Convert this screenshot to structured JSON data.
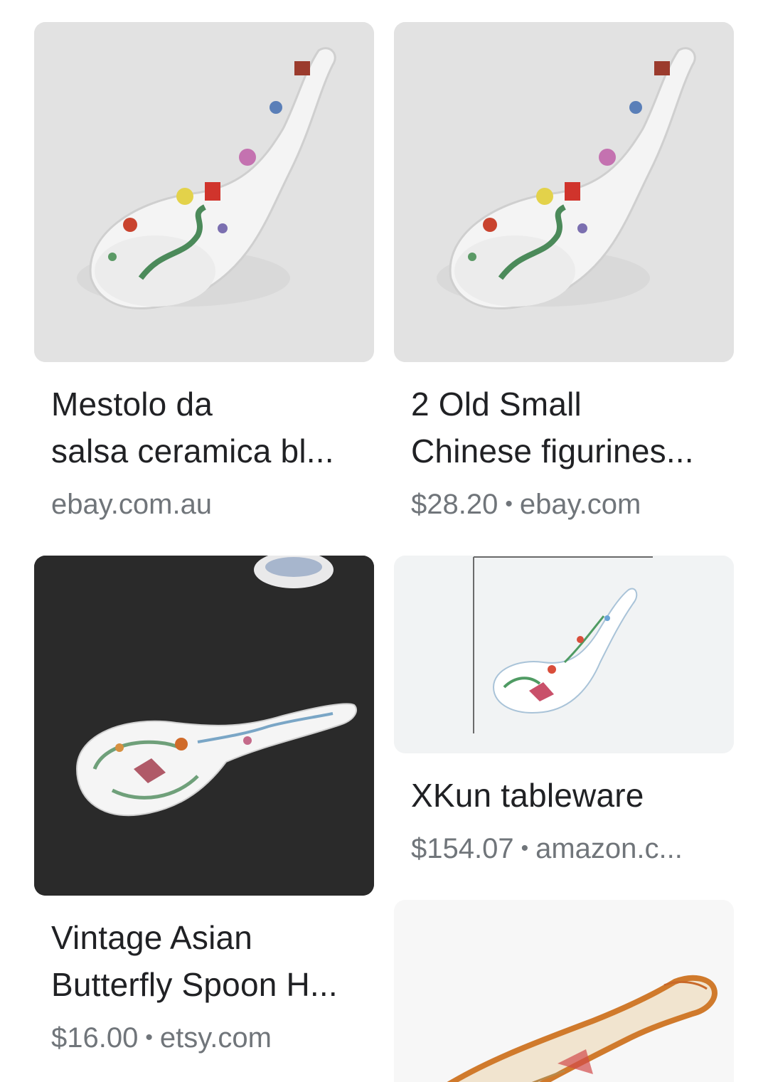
{
  "results": [
    {
      "title_line1": "Mestolo da",
      "title_line2": "salsa ceramica bl...",
      "price": "",
      "source": "ebay.com.au"
    },
    {
      "title_line1": "2 Old Small",
      "title_line2": "Chinese figurines...",
      "price": "$28.20",
      "source": "ebay.com"
    },
    {
      "title_line1": "Vintage Asian",
      "title_line2": "Butterfly Spoon H...",
      "price": "$16.00",
      "source": "etsy.com"
    },
    {
      "title_line1": "XKun tableware",
      "title_line2": "",
      "price": "$154.07",
      "source": "amazon.c..."
    }
  ],
  "separator": "•",
  "colors": {
    "title": "#202124",
    "meta": "#70757a",
    "thumb_bg_light": "#e3e3e3",
    "thumb_bg_dark": "#2b2b2b"
  }
}
